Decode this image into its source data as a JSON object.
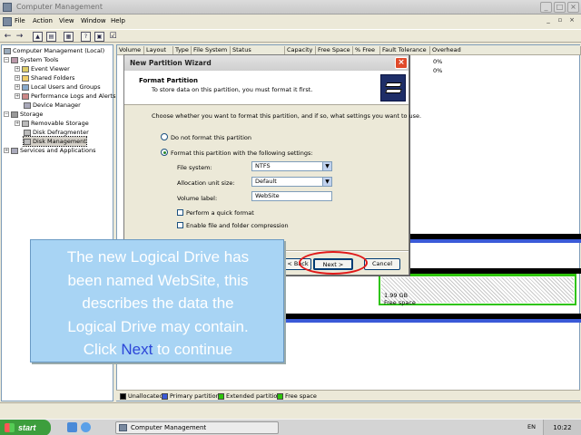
{
  "window": {
    "title": "Computer Management",
    "min": "_",
    "max": "□",
    "close": "×"
  },
  "menu": {
    "items": [
      "File",
      "Action",
      "View",
      "Window",
      "Help"
    ]
  },
  "tree": {
    "root": "Computer Management (Local)",
    "system_tools": "System Tools",
    "event_viewer": "Event Viewer",
    "shared_folders": "Shared Folders",
    "local_users": "Local Users and Groups",
    "perf_logs": "Performance Logs and Alerts",
    "device_manager": "Device Manager",
    "storage": "Storage",
    "removable": "Removable Storage",
    "defrag": "Disk Defragmenter",
    "disk_mgmt": "Disk Management",
    "services": "Services and Applications"
  },
  "columns": [
    "Volume",
    "Layout",
    "Type",
    "File System",
    "Status",
    "Capacity",
    "Free Space",
    "% Free",
    "Fault Tolerance",
    "Overhead"
  ],
  "volume_rows": [
    {
      "pct_free": "0%"
    },
    {
      "pct_free": "0%"
    }
  ],
  "disk_map": {
    "free_size": "1.99 GB",
    "free_label": "Free space"
  },
  "legend": [
    "Unallocated",
    "Primary partition",
    "Extended partition",
    "Free space"
  ],
  "legend_colors": {
    "unallocated": "#000000",
    "primary": "#3a5ad8",
    "extended": "#2ec40a",
    "free": "#2ec40a"
  },
  "dialog": {
    "title": "New Partition Wizard",
    "close": "×",
    "header_title": "Format Partition",
    "header_sub": "To store data on this partition, you must format it first.",
    "intro": "Choose whether you want to format this partition, and if so, what settings you want to use.",
    "opt_no_format": "Do not format this partition",
    "opt_format": "Format this partition with the following settings:",
    "file_system_label": "File system:",
    "file_system_value": "NTFS",
    "alloc_label": "Allocation unit size:",
    "alloc_value": "Default",
    "volume_label_label": "Volume label:",
    "volume_label_value": "WebSite",
    "quick_format": "Perform a quick format",
    "compression": "Enable file and folder compression",
    "back": "< Back",
    "next": "Next >",
    "cancel": "Cancel"
  },
  "callout": {
    "line1": "The new Logical Drive has",
    "line2": "been named WebSite, this",
    "line3": "describes the data the",
    "line4": "Logical Drive may contain.",
    "line5_pre": "Click ",
    "line5_link": "Next",
    "line5_post": " to continue"
  },
  "taskbar": {
    "start": "start",
    "task": "Computer Management",
    "lang": "EN",
    "clock": "10:22"
  }
}
